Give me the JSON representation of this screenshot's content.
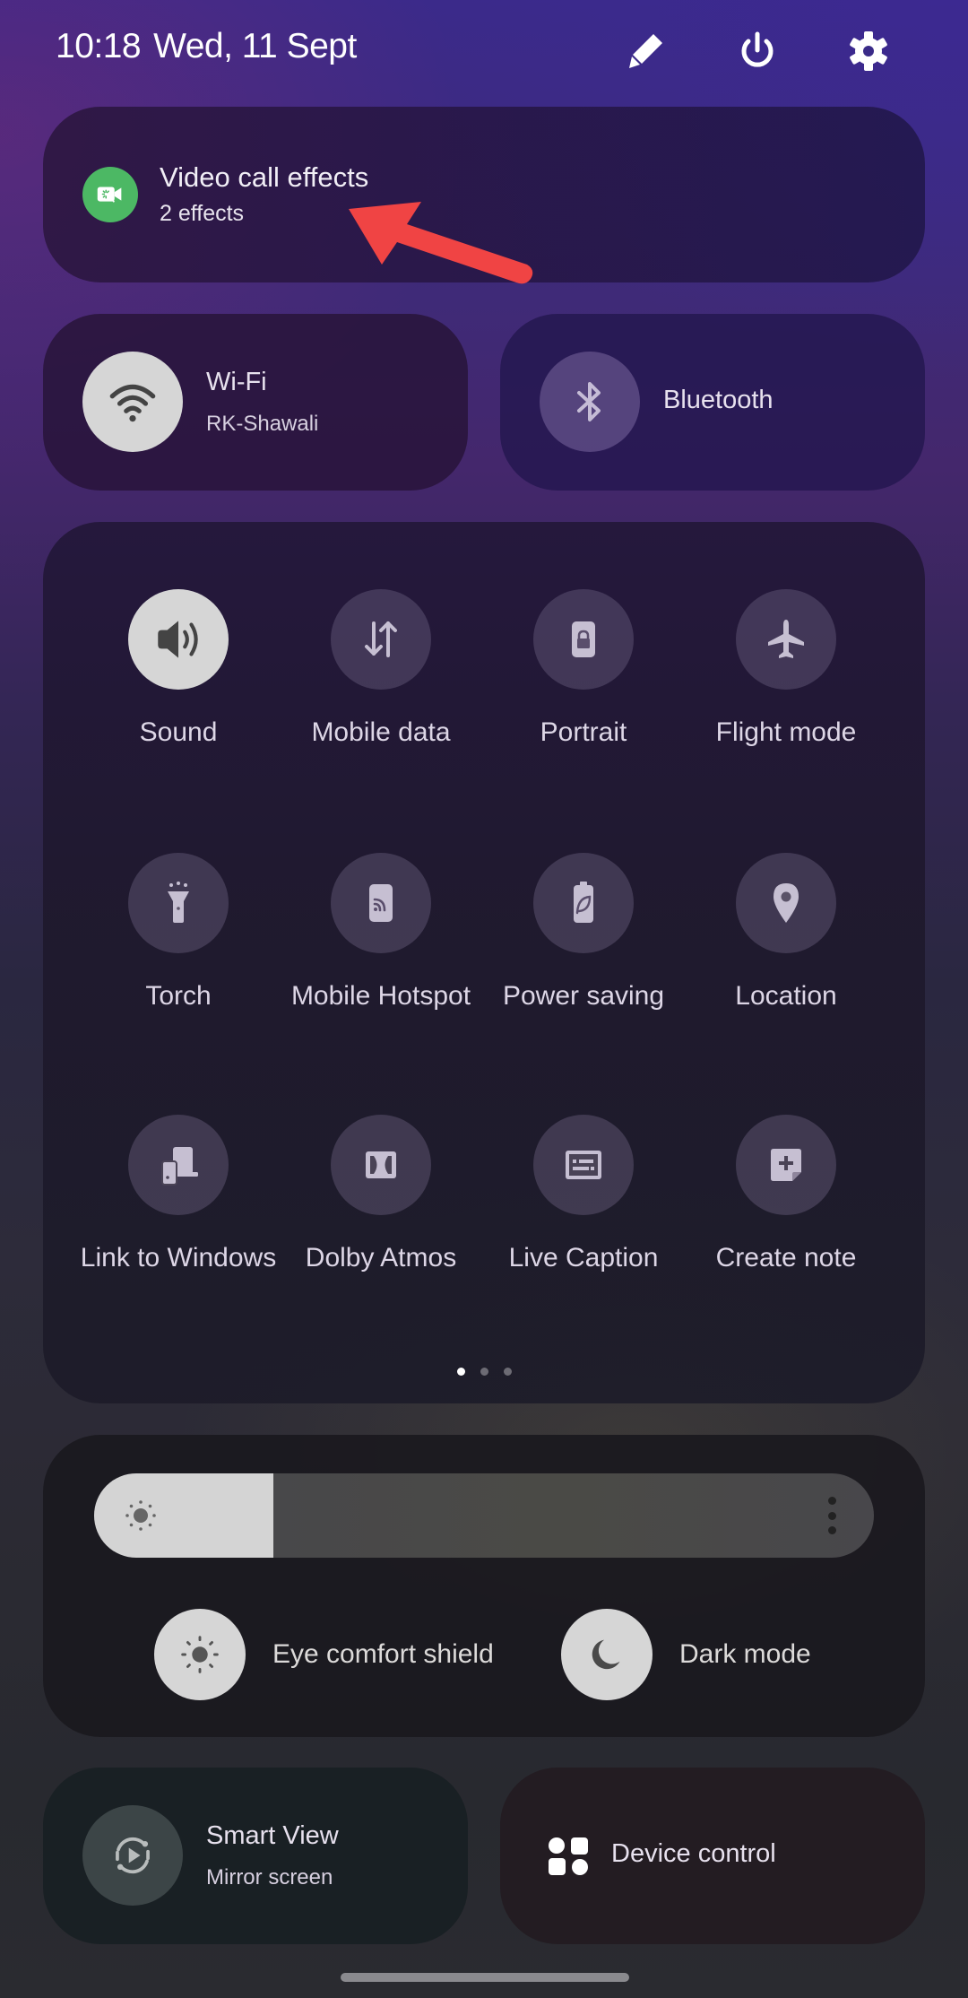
{
  "header": {
    "time": "10:18",
    "date": "Wed, 11 Sept",
    "icons": [
      "edit-pencil-icon",
      "power-icon",
      "settings-gear-icon"
    ]
  },
  "video_call_effects": {
    "title": "Video call effects",
    "subtitle": "2 effects",
    "icon": "video-call-effects-icon",
    "icon_color": "#4cb864"
  },
  "wifi": {
    "title": "Wi-Fi",
    "subtitle": "RK-Shawali",
    "state": "on",
    "icon": "wifi-icon"
  },
  "bluetooth": {
    "title": "Bluetooth",
    "state": "off",
    "icon": "bluetooth-icon"
  },
  "quick_tiles": [
    {
      "label": "Sound",
      "icon": "sound-icon",
      "state": "on"
    },
    {
      "label": "Mobile data",
      "icon": "mobile-data-icon",
      "state": "off"
    },
    {
      "label": "Portrait",
      "icon": "portrait-lock-icon",
      "state": "off"
    },
    {
      "label": "Flight mode",
      "icon": "airplane-icon",
      "state": "off"
    },
    {
      "label": "Torch",
      "icon": "torch-icon",
      "state": "off"
    },
    {
      "label": "Mobile Hotspot",
      "icon": "hotspot-icon",
      "state": "off"
    },
    {
      "label": "Power saving",
      "icon": "power-saving-icon",
      "state": "off"
    },
    {
      "label": "Location",
      "icon": "location-pin-icon",
      "state": "off"
    },
    {
      "label": "Link to Windows",
      "icon": "link-to-windows-icon",
      "state": "off"
    },
    {
      "label": "Dolby Atmos",
      "icon": "dolby-icon",
      "state": "off"
    },
    {
      "label": "Live Caption",
      "icon": "live-caption-icon",
      "state": "off"
    },
    {
      "label": "Create note",
      "icon": "create-note-icon",
      "state": "off"
    }
  ],
  "pager": {
    "pages": 3,
    "current": 1
  },
  "brightness": {
    "level_percent": 23,
    "icon": "brightness-sun-icon",
    "more_icon": "more-vertical-icon"
  },
  "eye_comfort": {
    "label": "Eye comfort shield",
    "state": "on"
  },
  "dark_mode": {
    "label": "Dark mode",
    "state": "on"
  },
  "smart_view": {
    "title": "Smart View",
    "subtitle": "Mirror screen",
    "icon": "smart-view-icon"
  },
  "device_control": {
    "title": "Device control",
    "icon": "device-control-icon"
  },
  "annotation": {
    "type": "arrow",
    "color": "#f04444",
    "points_to": "video_call_effects"
  }
}
